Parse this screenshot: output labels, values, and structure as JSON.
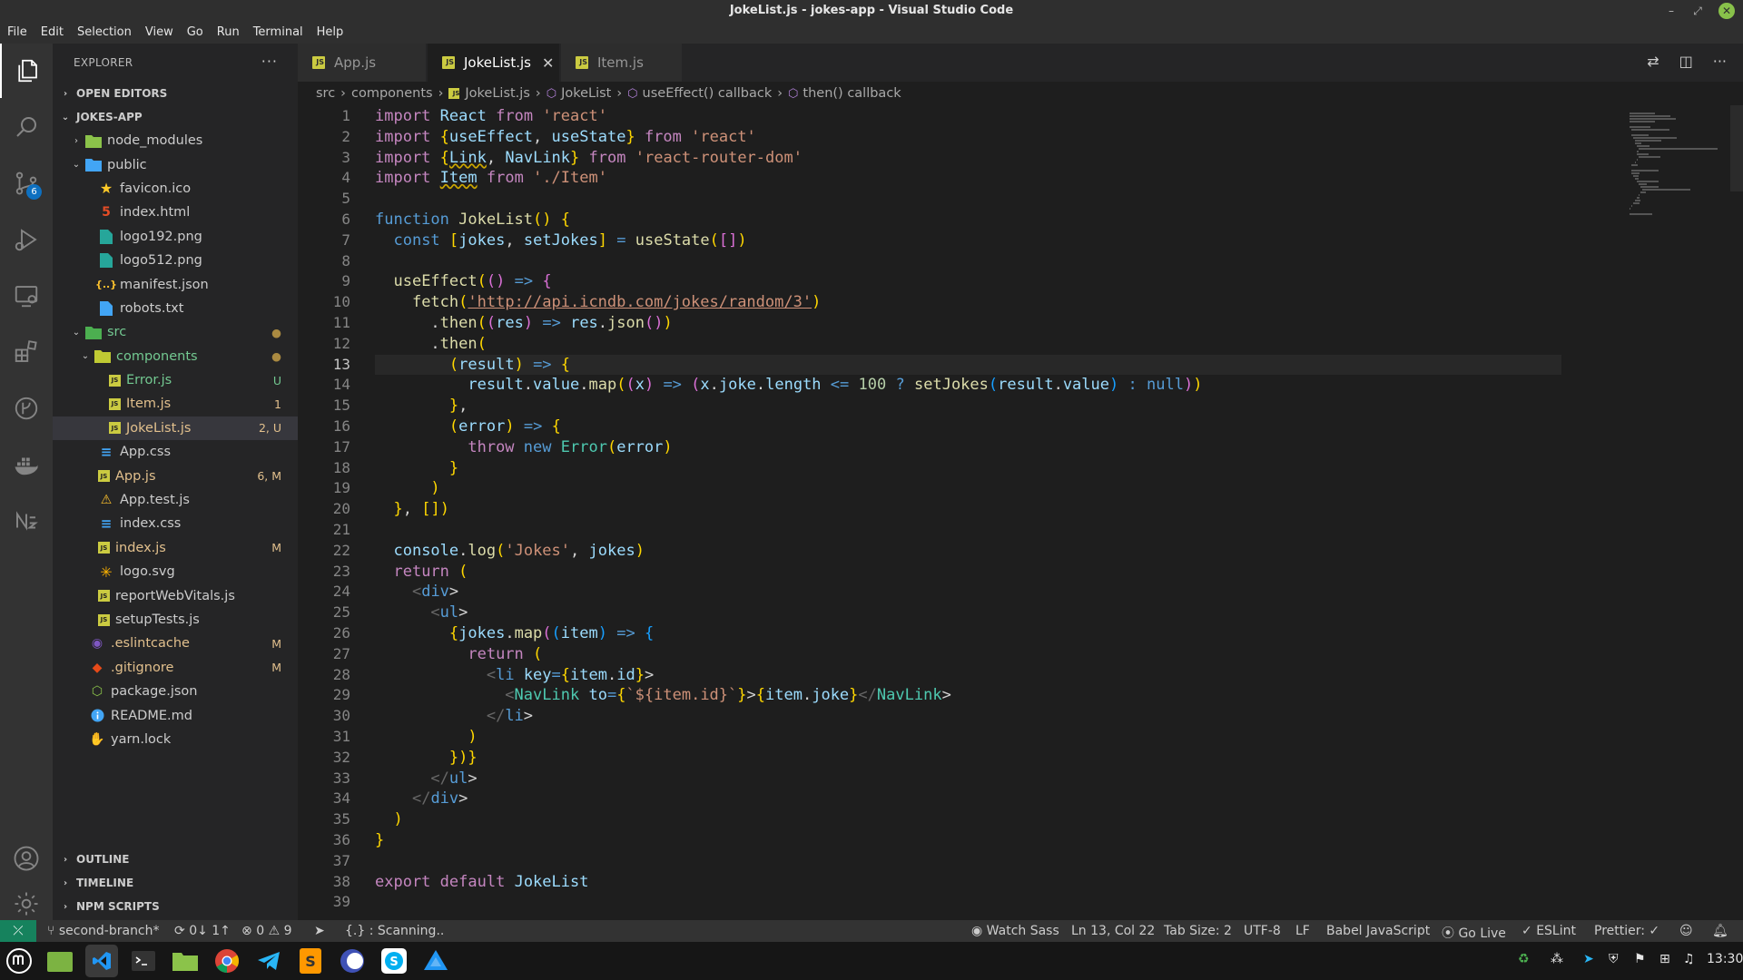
{
  "window": {
    "title": "JokeList.js - jokes-app - Visual Studio Code"
  },
  "menu": [
    "File",
    "Edit",
    "Selection",
    "View",
    "Go",
    "Run",
    "Terminal",
    "Help"
  ],
  "activity_bar": {
    "items": [
      "explorer-icon",
      "search-icon",
      "source-control-icon",
      "run-debug-icon",
      "remote-explorer-icon",
      "extensions-icon",
      "git-graph-icon",
      "docker-icon",
      "n-icon"
    ],
    "scm_badge": "6",
    "bottom": [
      "account-icon",
      "settings-gear-icon"
    ]
  },
  "sidebar": {
    "title": "EXPLORER",
    "more": "···",
    "open_editors": "OPEN EDITORS",
    "project": "JOKES-APP",
    "tree": [
      {
        "name": "node_modules",
        "status": ""
      },
      {
        "name": "public",
        "status": ""
      },
      {
        "name": "favicon.ico",
        "status": ""
      },
      {
        "name": "index.html",
        "status": ""
      },
      {
        "name": "logo192.png",
        "status": ""
      },
      {
        "name": "logo512.png",
        "status": ""
      },
      {
        "name": "manifest.json",
        "status": ""
      },
      {
        "name": "robots.txt",
        "status": ""
      },
      {
        "name": "src",
        "status": "●"
      },
      {
        "name": "components",
        "status": "●"
      },
      {
        "name": "Error.js",
        "status": "U"
      },
      {
        "name": "Item.js",
        "status": "1"
      },
      {
        "name": "JokeList.js",
        "status": "2, U"
      },
      {
        "name": "App.css",
        "status": ""
      },
      {
        "name": "App.js",
        "status": "6, M"
      },
      {
        "name": "App.test.js",
        "status": ""
      },
      {
        "name": "index.css",
        "status": ""
      },
      {
        "name": "index.js",
        "status": "M"
      },
      {
        "name": "logo.svg",
        "status": ""
      },
      {
        "name": "reportWebVitals.js",
        "status": ""
      },
      {
        "name": "setupTests.js",
        "status": ""
      },
      {
        "name": ".eslintcache",
        "status": "M"
      },
      {
        "name": ".gitignore",
        "status": "M"
      },
      {
        "name": "package.json",
        "status": ""
      },
      {
        "name": "README.md",
        "status": ""
      },
      {
        "name": "yarn.lock",
        "status": ""
      }
    ],
    "outline": "OUTLINE",
    "timeline": "TIMELINE",
    "npm_scripts": "NPM SCRIPTS"
  },
  "tabs": [
    {
      "label": "App.js",
      "active": false
    },
    {
      "label": "JokeList.js",
      "active": true
    },
    {
      "label": "Item.js",
      "active": false
    }
  ],
  "tab_close": "✕",
  "breadcrumb": [
    "src",
    "components",
    "JokeList.js",
    "JokeList",
    "useEffect() callback",
    "then() callback"
  ],
  "editor": {
    "current_line": 13,
    "lines": [
      "import React from 'react'",
      "import {useEffect, useState} from 'react'",
      "import {Link, NavLink} from 'react-router-dom'",
      "import Item from './Item'",
      "",
      "function JokeList() {",
      "  const [jokes, setJokes] = useState([])",
      "",
      "  useEffect(() => {",
      "    fetch('http://api.icndb.com/jokes/random/3')",
      "      .then((res) => res.json())",
      "      .then(",
      "        (result) => {",
      "          result.value.map((x) => (x.joke.length <= 100 ? setJokes(result.value) : null))",
      "        },",
      "        (error) => {",
      "          throw new Error(error)",
      "        }",
      "      )",
      "  }, [])",
      "",
      "  console.log('Jokes', jokes)",
      "  return (",
      "    <div>",
      "      <ul>",
      "        {jokes.map((item) => {",
      "          return (",
      "            <li key={item.id}>",
      "              <NavLink to={`${item.id}`}>{item.joke}</NavLink>",
      "            </li>",
      "          )",
      "        })}",
      "      </ul>",
      "    </div>",
      "  )",
      "}",
      "",
      "export default JokeList",
      ""
    ]
  },
  "status_bar": {
    "branch": "second-branch*",
    "sync": "0↓ 1↑",
    "errors": "0",
    "warnings": "9",
    "scanning": "{.} : Scanning..",
    "watch_sass": "Watch Sass",
    "position": "Ln 13, Col 22",
    "tab_size": "Tab Size: 2",
    "encoding": "UTF-8",
    "eol": "LF",
    "language": "Babel JavaScript",
    "go_live": "Go Live",
    "eslint": "ESLint",
    "prettier": "Prettier: ✓"
  },
  "taskbar": {
    "apps": [
      "mint-menu",
      "files",
      "vscode",
      "terminal",
      "file-manager",
      "chrome",
      "telegram",
      "sublime",
      "eclipse",
      "skype",
      "app"
    ],
    "clock": "13:30"
  },
  "colors": {
    "accent": "#007acc",
    "remote": "#16825d",
    "modified": "#e2c08d",
    "untracked": "#73c991"
  }
}
